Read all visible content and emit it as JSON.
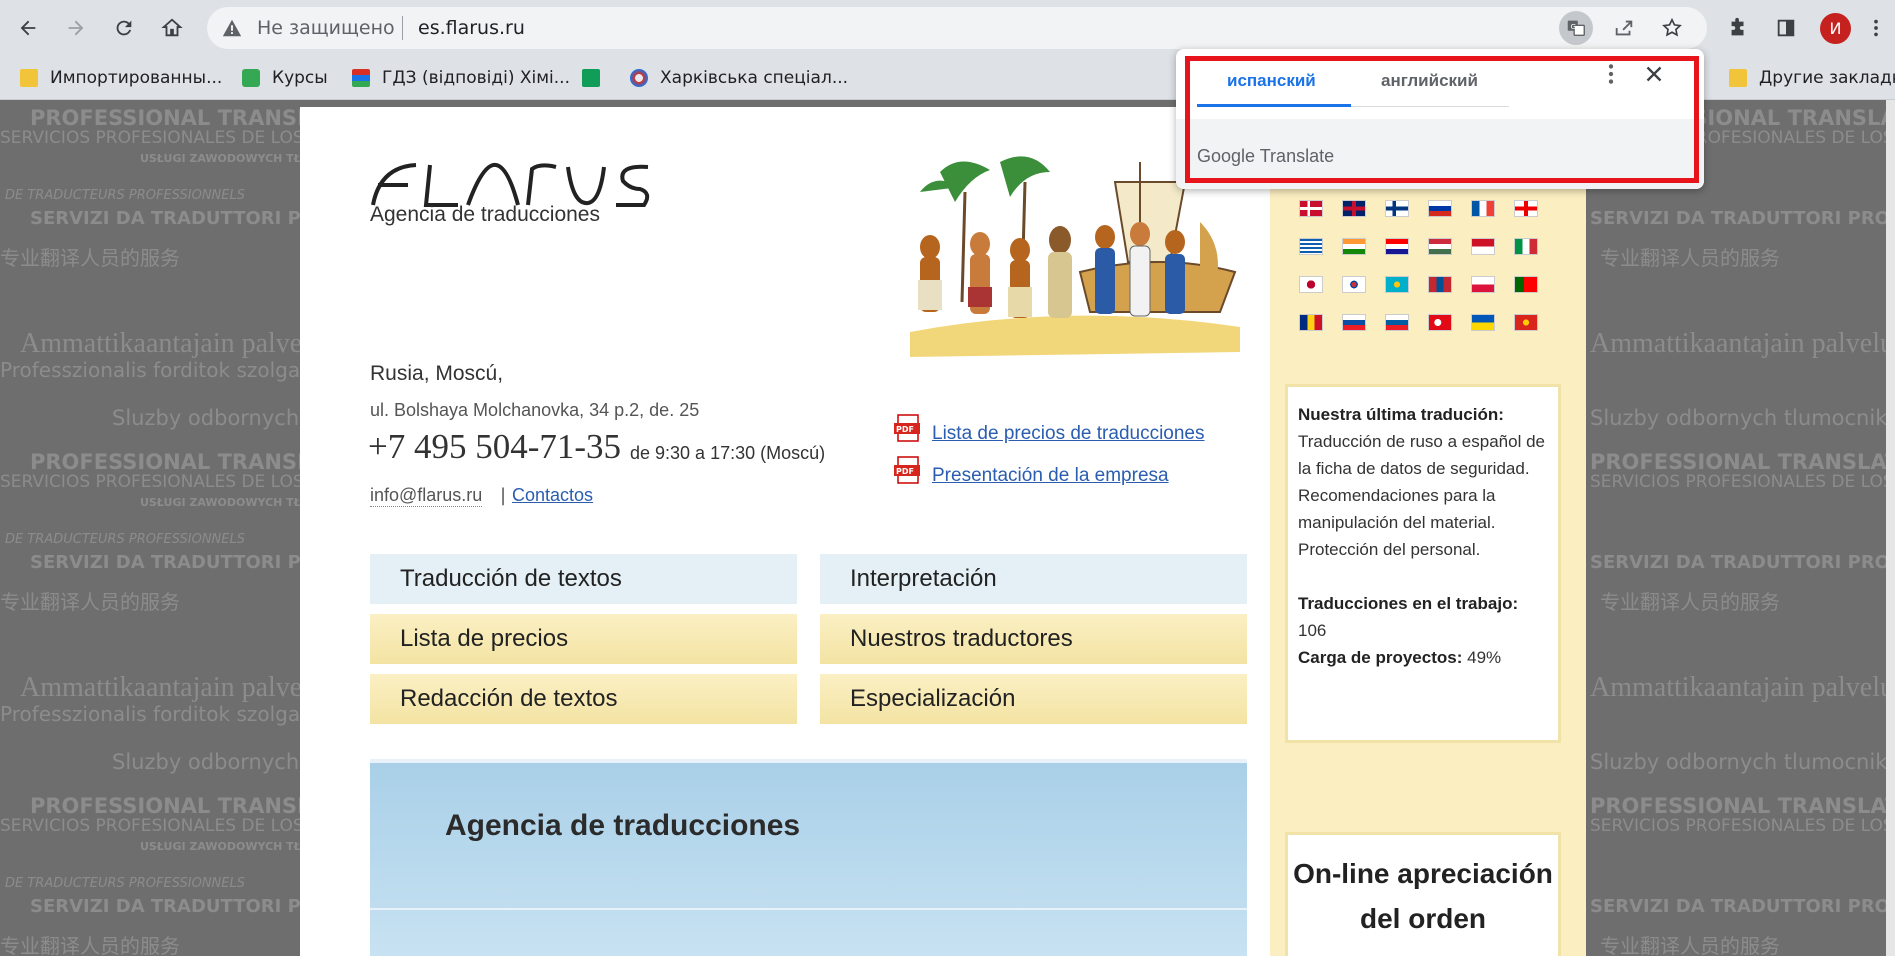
{
  "browser": {
    "security_text": "Не защищено",
    "url": "es.flarus.ru",
    "profile_initial": "И"
  },
  "bookmarks": {
    "items": [
      {
        "label": "Импортированны..."
      },
      {
        "label": "Курсы"
      },
      {
        "label": "ГДЗ (відповіді) Хімі..."
      },
      {
        "label": ""
      },
      {
        "label": "Харківська спеціал..."
      }
    ],
    "other": "Другие закладки"
  },
  "translate_popup": {
    "tab_source": "испанский",
    "tab_target": "английский",
    "brand_google": "Google",
    "brand_translate": "Translate"
  },
  "watermark": {
    "line1": "PROFESSIONAL TRANSLATION SERVICES",
    "line2": "SERVICIOS PROFESIONALES DE LOS TRADUCTORES",
    "line3": "USŁUGI ZAWODOWYCH TŁUMACZY",
    "line4": "DE TRADUCTEURS PROFESSIONNELS",
    "line5": "SERVIZI DA TRADUTTORI PROFESSIONISTI",
    "line6": "专业翻译人员的服务",
    "line7": "Ammattikaantajain palvelut",
    "line8": "Professzionalis forditok szolgaltatasai",
    "line9": "Sluzby odbornych tlumocniku"
  },
  "site": {
    "tagline": "Agencia de traducciones",
    "address_city": "Rusia, Moscú,",
    "address_street": "ul. Bolshaya Molchanovka, 34 p.2, de. 25",
    "phone": "+7 495 504-71-35",
    "hours": "de 9:30 a 17:30 (Moscú)",
    "email": "info@flarus.ru",
    "contacts": "Contactos",
    "pdf_links": [
      "Lista de precios de traducciones",
      "Presentación de la empresa"
    ],
    "menu": [
      {
        "label": "Traducción de textos"
      },
      {
        "label": "Interpretación"
      },
      {
        "label": "Lista de precios"
      },
      {
        "label": "Nuestros traductores"
      },
      {
        "label": "Redacción de textos"
      },
      {
        "label": "Especialización"
      }
    ],
    "hero_title": "Agencia de traducciones"
  },
  "sidebar": {
    "latest_title": "Nuestra última tradución:",
    "latest_text": "Traducción de ruso a español de la ficha de datos de seguridad. Recomendaciones para la manipulación del material. Protección del personal.",
    "in_work_label": "Traducciones en el trabajo:",
    "in_work_value": "106",
    "load_label": "Carga de proyectos:",
    "load_value": "49%",
    "online_title": "On-line apreciación del orden"
  },
  "colors": {
    "link": "#2a5db0",
    "translate_accent": "#1a73e8",
    "highlight_box": "#e8141c",
    "sidebar_bg": "#fbeec0"
  }
}
